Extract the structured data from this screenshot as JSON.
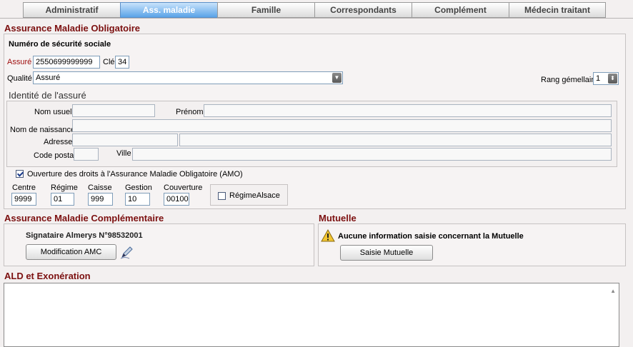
{
  "tabs": [
    {
      "label": "Administratif",
      "active": false
    },
    {
      "label": "Ass. maladie",
      "active": true
    },
    {
      "label": "Famille",
      "active": false
    },
    {
      "label": "Correspondants",
      "active": false
    },
    {
      "label": "Complément",
      "active": false
    },
    {
      "label": "Médecin traitant",
      "active": false
    }
  ],
  "amo": {
    "title": "Assurance Maladie Obligatoire",
    "nss_label": "Numéro de sécurité sociale",
    "assure_label": "Assuré",
    "assure_value": "2550699999999",
    "cle_label": "Clé",
    "cle_value": "34",
    "qualite_label": "Qualité",
    "qualite_value": "Assuré",
    "rang_label": "Rang gémellaire",
    "rang_value": "1",
    "identity": {
      "title": "Identité de l'assuré",
      "nom_usuel": "Nom usuel",
      "prenom": "Prénom",
      "nom_naissance": "Nom de naissance",
      "adresse": "Adresse",
      "code_postal": "Code postal",
      "ville": "Ville"
    },
    "ouverture_label": "Ouverture des droits à l'Assurance Maladie Obligatoire (AMO)",
    "ouverture_checked": true,
    "codes": {
      "centre_label": "Centre",
      "centre_value": "9999",
      "regime_label": "Régime",
      "regime_value": "01",
      "caisse_label": "Caisse",
      "caisse_value": "999",
      "gestion_label": "Gestion",
      "gestion_value": "10",
      "couverture_label": "Couverture",
      "couverture_value": "00100"
    },
    "regime_alsace_label": "RégimeAlsace",
    "regime_alsace_checked": false
  },
  "amc": {
    "title": "Assurance Maladie Complémentaire",
    "signataire": "Signataire Almerys N°98532001",
    "button": "Modification AMC"
  },
  "mutuelle": {
    "title": "Mutuelle",
    "warning": "Aucune information saisie concernant la Mutuelle",
    "button": "Saisie Mutuelle"
  },
  "ald": {
    "title": "ALD et Exonération"
  }
}
